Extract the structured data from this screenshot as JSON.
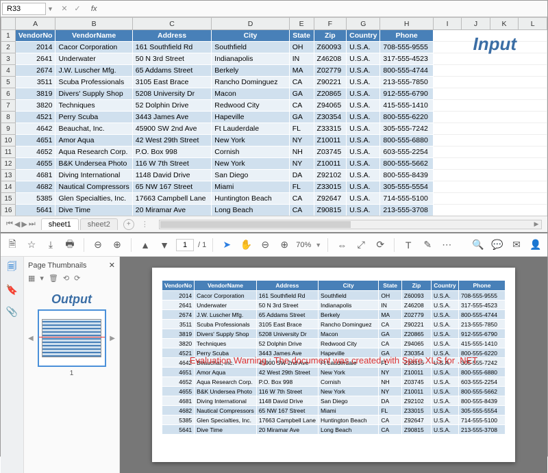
{
  "formula_bar": {
    "cell_ref": "R33",
    "fx_label": "fx"
  },
  "columns": [
    "A",
    "B",
    "C",
    "D",
    "E",
    "F",
    "G",
    "H",
    "I",
    "J",
    "K",
    "L"
  ],
  "headers": [
    "VendorNo",
    "VendorName",
    "Address",
    "City",
    "State",
    "Zip",
    "Country",
    "Phone"
  ],
  "rows": [
    {
      "no": "2014",
      "name": "Cacor Corporation",
      "addr": "161 Southfield Rd",
      "city": "Southfield",
      "st": "OH",
      "zip": "Z60093",
      "cn": "U.S.A.",
      "ph": "708-555-9555"
    },
    {
      "no": "2641",
      "name": "Underwater",
      "addr": "50 N 3rd Street",
      "city": "Indianapolis",
      "st": "IN",
      "zip": "Z46208",
      "cn": "U.S.A.",
      "ph": "317-555-4523"
    },
    {
      "no": "2674",
      "name": "J.W.  Luscher Mfg.",
      "addr": "65 Addams Street",
      "city": "Berkely",
      "st": "MA",
      "zip": "Z02779",
      "cn": "U.S.A.",
      "ph": "800-555-4744"
    },
    {
      "no": "3511",
      "name": "Scuba Professionals",
      "addr": "3105 East Brace",
      "city": "Rancho Dominguez",
      "st": "CA",
      "zip": "Z90221",
      "cn": "U.S.A.",
      "ph": "213-555-7850"
    },
    {
      "no": "3819",
      "name": "Divers'  Supply Shop",
      "addr": "5208 University Dr",
      "city": "Macon",
      "st": "GA",
      "zip": "Z20865",
      "cn": "U.S.A.",
      "ph": "912-555-6790"
    },
    {
      "no": "3820",
      "name": "Techniques",
      "addr": "52 Dolphin Drive",
      "city": "Redwood City",
      "st": "CA",
      "zip": "Z94065",
      "cn": "U.S.A.",
      "ph": "415-555-1410"
    },
    {
      "no": "4521",
      "name": "Perry Scuba",
      "addr": "3443 James Ave",
      "city": "Hapeville",
      "st": "GA",
      "zip": "Z30354",
      "cn": "U.S.A.",
      "ph": "800-555-6220"
    },
    {
      "no": "4642",
      "name": "Beauchat, Inc.",
      "addr": "45900 SW 2nd Ave",
      "city": "Ft Lauderdale",
      "st": "FL",
      "zip": "Z33315",
      "cn": "U.S.A.",
      "ph": "305-555-7242"
    },
    {
      "no": "4651",
      "name": "Amor Aqua",
      "addr": "42 West 29th Street",
      "city": "New York",
      "st": "NY",
      "zip": "Z10011",
      "cn": "U.S.A.",
      "ph": "800-555-6880"
    },
    {
      "no": "4652",
      "name": "Aqua Research Corp.",
      "addr": "P.O. Box 998",
      "city": "Cornish",
      "st": "NH",
      "zip": "Z03745",
      "cn": "U.S.A.",
      "ph": "603-555-2254"
    },
    {
      "no": "4655",
      "name": "B&K Undersea Photo",
      "addr": "116 W 7th Street",
      "city": "New York",
      "st": "NY",
      "zip": "Z10011",
      "cn": "U.S.A.",
      "ph": "800-555-5662"
    },
    {
      "no": "4681",
      "name": "Diving International",
      "addr": "1148 David Drive",
      "city": "San Diego",
      "st": "DA",
      "zip": "Z92102",
      "cn": "U.S.A.",
      "ph": "800-555-8439"
    },
    {
      "no": "4682",
      "name": "Nautical Compressors",
      "addr": "65 NW 167 Street",
      "city": "Miami",
      "st": "FL",
      "zip": "Z33015",
      "cn": "U.S.A.",
      "ph": "305-555-5554"
    },
    {
      "no": "5385",
      "name": "Glen Specialties, Inc.",
      "addr": "17663 Campbell Lane",
      "city": "Huntington Beach",
      "st": "CA",
      "zip": "Z92647",
      "cn": "U.S.A.",
      "ph": "714-555-5100"
    },
    {
      "no": "5641",
      "name": "Dive Time",
      "addr": "20 Miramar Ave",
      "city": "Long Beach",
      "st": "CA",
      "zip": "Z90815",
      "cn": "U.S.A.",
      "ph": "213-555-3708"
    }
  ],
  "input_label": "Input",
  "sheet_tabs": {
    "active": "sheet1",
    "inactive": "sheet2",
    "add": "+"
  },
  "pdf_toolbar": {
    "page_current": "1",
    "page_total": "/ 1",
    "zoom": "70%"
  },
  "thumbnails": {
    "title": "Page Thumbnails",
    "output_label": "Output",
    "page_num": "1"
  },
  "eval_warning": "Evaluation Warning : The document was created with  Spire.XLS for .NET"
}
